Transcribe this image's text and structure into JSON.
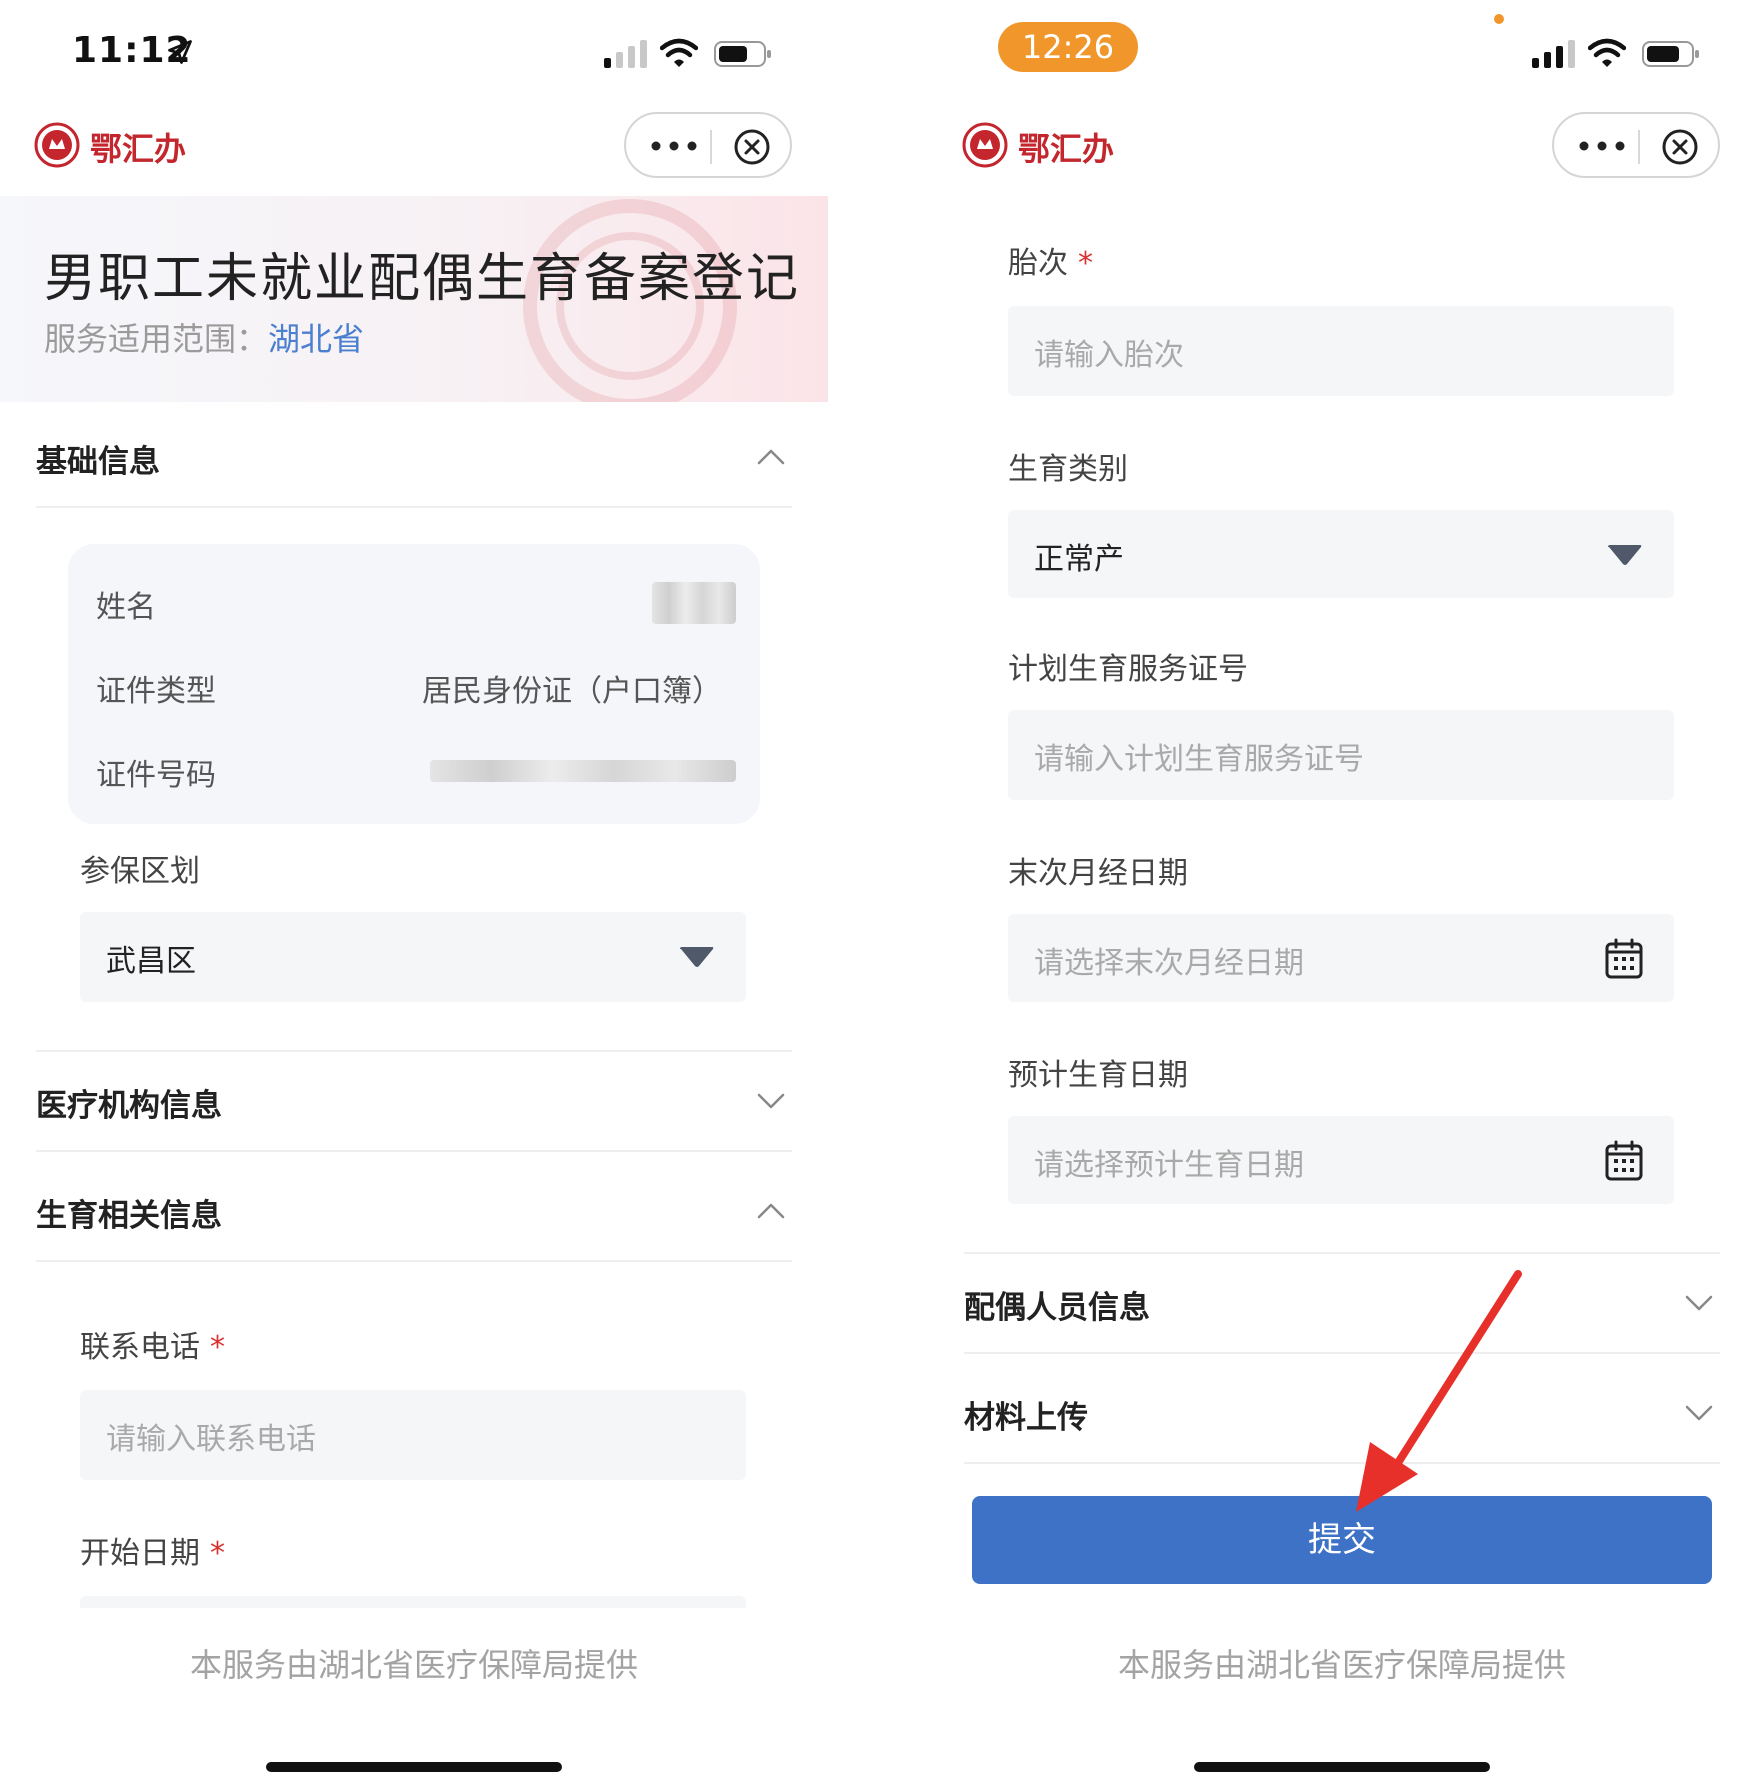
{
  "left_screen": {
    "status_bar": {
      "time": "11:12"
    },
    "app_header": {
      "logo_text": "鄂汇办"
    },
    "hero": {
      "title": "男职工未就业配偶生育备案登记",
      "scope_label": "服务适用范围：",
      "scope_value": "湖北省"
    },
    "sections": {
      "basic_info": {
        "title": "基础信息"
      },
      "medical_institution": {
        "title": "医疗机构信息"
      },
      "maternity_info": {
        "title": "生育相关信息"
      }
    },
    "basic_info_card": {
      "rows": [
        {
          "label": "姓名",
          "value": ""
        },
        {
          "label": "证件类型",
          "value": "居民身份证（户口簿）"
        },
        {
          "label": "证件号码",
          "value": ""
        }
      ]
    },
    "insurance_region": {
      "label": "参保区划",
      "value": "武昌区"
    },
    "contact_phone": {
      "label": "联系电话",
      "required_mark": "*",
      "placeholder": "请输入联系电话"
    },
    "start_date": {
      "label": "开始日期",
      "required_mark": "*"
    },
    "footer": "本服务由湖北省医疗保障局提供"
  },
  "right_screen": {
    "status_bar": {
      "time": "12:26"
    },
    "app_header": {
      "logo_text": "鄂汇办"
    },
    "pregnancy_count": {
      "label": "胎次",
      "required_mark": "*",
      "placeholder": "请输入胎次"
    },
    "birth_type": {
      "label": "生育类别",
      "value": "正常产"
    },
    "family_planning_cert": {
      "label": "计划生育服务证号",
      "placeholder": "请输入计划生育服务证号"
    },
    "last_menstrual_date": {
      "label": "末次月经日期",
      "placeholder": "请选择末次月经日期"
    },
    "expected_birth_date": {
      "label": "预计生育日期",
      "placeholder": "请选择预计生育日期"
    },
    "sections": {
      "spouse_info": {
        "title": "配偶人员信息"
      },
      "material_upload": {
        "title": "材料上传"
      }
    },
    "submit_label": "提交",
    "footer": "本服务由湖北省医疗保障局提供"
  },
  "colors": {
    "accent_blue": "#3e72c6",
    "status_orange": "#f0962a",
    "required_red": "#d93030",
    "annotation_arrow": "#e8302a"
  },
  "icons": [
    "location-arrow-icon",
    "signal-icon",
    "wifi-icon",
    "battery-icon",
    "emblem-icon",
    "more-dots-icon",
    "close-circle-icon",
    "chevron-up-icon",
    "chevron-down-icon",
    "dropdown-caret-icon",
    "calendar-icon",
    "red-arrow-annotation"
  ]
}
